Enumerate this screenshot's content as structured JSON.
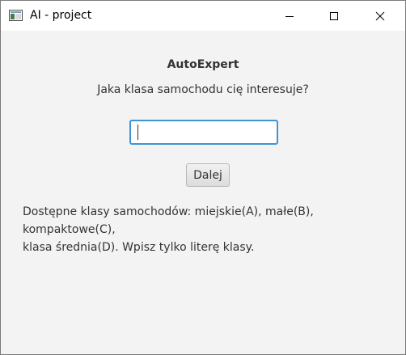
{
  "window": {
    "title": "AI - project",
    "icon": "app-window-icon",
    "controls": [
      "minimize-icon",
      "maximize-icon",
      "close-icon"
    ]
  },
  "main": {
    "heading": "AutoExpert",
    "question": "Jaka klasa samochodu cię interesuje?",
    "answer_value": "",
    "next_label": "Dalej",
    "info_line1": "Dostępne klasy samochodów: miejskie(A), małe(B), kompaktowe(C),",
    "info_line2": "klasa średnia(D). Wpisz tylko literę klasy."
  },
  "colors": {
    "background": "#f3f3f3",
    "focus_border": "#3d95d3",
    "text": "#333333"
  }
}
